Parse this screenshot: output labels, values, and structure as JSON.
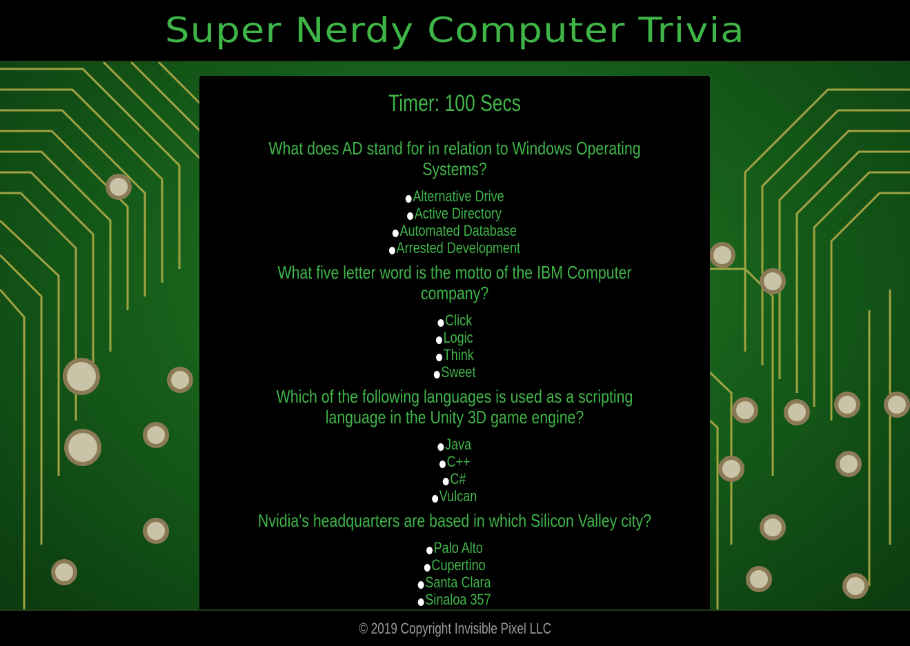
{
  "header": {
    "title": "Super Nerdy Computer Trivia"
  },
  "timer": {
    "text": "Timer: 100 Secs"
  },
  "questions": [
    {
      "text": "What does AD stand for in relation to Windows Operating Systems?",
      "answers": [
        "Alternative Drive",
        "Active Directory",
        "Automated Database",
        "Arrested Development"
      ]
    },
    {
      "text": "What five letter word is the motto of the IBM Computer company?",
      "answers": [
        "Click",
        "Logic",
        "Think",
        "Sweet"
      ]
    },
    {
      "text": "Which of the following languages is used as a scripting language in the Unity 3D game engine?",
      "answers": [
        "Java",
        "C++",
        "C#",
        "Vulcan"
      ]
    },
    {
      "text": "Nvidia's headquarters are based in which Silicon Valley city?",
      "answers": [
        "Palo Alto",
        "Cupertino",
        "Santa Clara",
        "Sinaloa 357"
      ]
    }
  ],
  "footer": {
    "copyright": "© 2019 Copyright Invisible Pixel LLC"
  },
  "colors": {
    "accent": "#3fb548",
    "background": "#000000",
    "footer_text": "#9a9a9a"
  }
}
